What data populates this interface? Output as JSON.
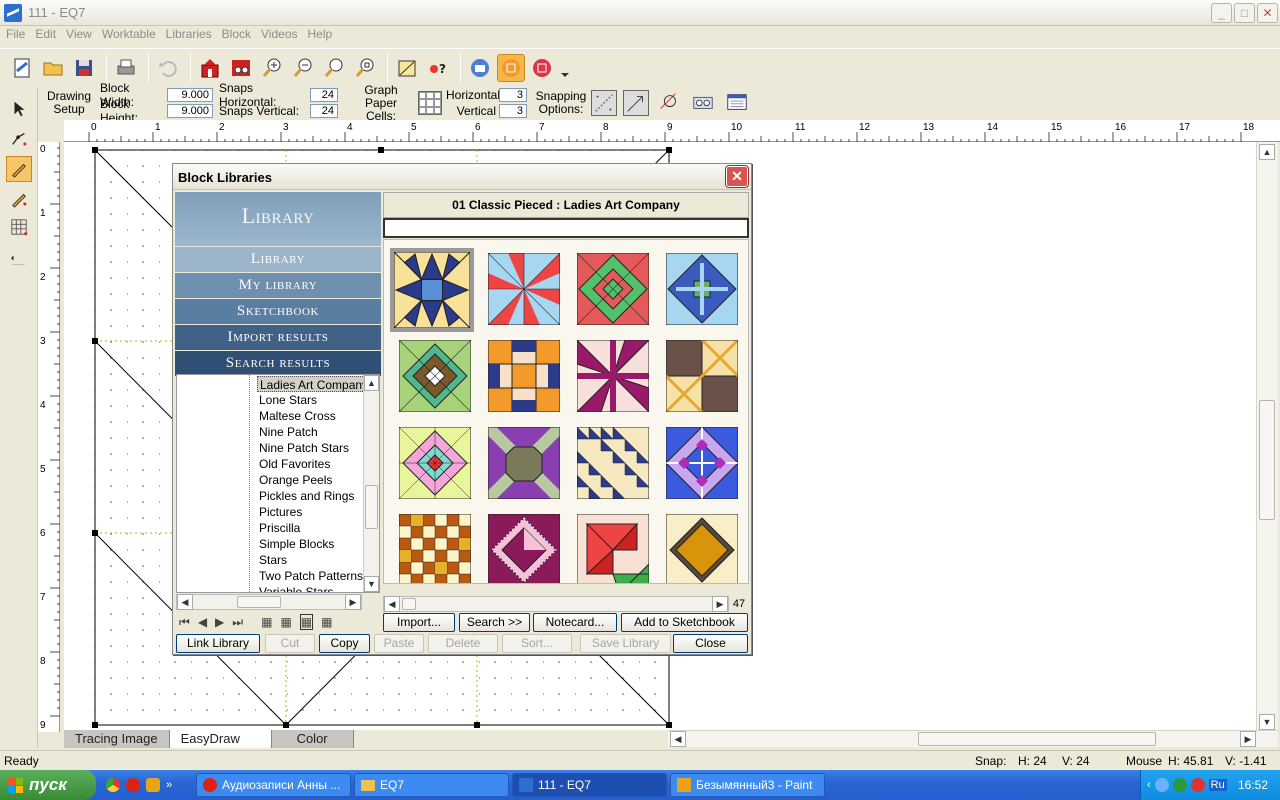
{
  "window": {
    "title": "111 - EQ7",
    "minimize": "_",
    "maximize": "□",
    "close": "✕"
  },
  "menu": [
    "File",
    "Edit",
    "View",
    "Worktable",
    "Libraries",
    "Block",
    "Videos",
    "Help"
  ],
  "options": {
    "drawing_setup_line1": "Drawing",
    "drawing_setup_line2": "Setup",
    "block_width_label": "Block Width:",
    "block_width_value": "9.000",
    "block_height_label": "Block Height:",
    "block_height_value": "9.000",
    "snaps_h_label": "Snaps Horizontal:",
    "snaps_h_value": "24",
    "snaps_v_label": "Snaps Vertical:",
    "snaps_v_value": "24",
    "graph_paper_line1": "Graph Paper",
    "graph_paper_line2": "Cells:",
    "horizontal_label": "Horizontal",
    "horizontal_value": "3",
    "vertical_label": "Vertical",
    "vertical_value": "3",
    "snapping_line1": "Snapping",
    "snapping_line2": "Options:"
  },
  "ruler_h": [
    "0",
    "1",
    "2",
    "3",
    "4",
    "5",
    "6",
    "7",
    "8",
    "9",
    "10",
    "11",
    "12",
    "13",
    "14",
    "15",
    "16",
    "17",
    "18"
  ],
  "ruler_v": [
    "0",
    "1",
    "2",
    "3",
    "4",
    "5",
    "6",
    "7",
    "8",
    "9"
  ],
  "canvas_tabs": [
    "Tracing Image",
    "EasyDraw",
    "Color"
  ],
  "status": {
    "ready": "Ready",
    "snap": "Snap:",
    "snap_h": "H:  24",
    "snap_v": "V:  24",
    "mouse": "Mouse",
    "mouse_h": "H: 45.81",
    "mouse_v": "V:  -1.41"
  },
  "dialog": {
    "title": "Block Libraries",
    "library_header": "Library",
    "nav": [
      "Library",
      "My library",
      "Sketchbook",
      "Import results",
      "Search results"
    ],
    "collection_title": "01 Classic Pieced  :  Ladies Art Company",
    "tree_items": [
      "Ladies Art Company",
      "Lone Stars",
      "Maltese Cross",
      "Nine Patch",
      "Nine Patch Stars",
      "Old Favorites",
      "Orange Peels",
      "Pickles and Rings",
      "Pictures",
      "Priscilla",
      "Simple Blocks",
      "Stars",
      "Two Patch Patterns",
      "Variable Stars"
    ],
    "block_count": "47",
    "buttons_row1": [
      "Import...",
      "Search    >>",
      "Notecard...",
      "Add to Sketchbook"
    ],
    "buttons_row2": [
      "Link Library",
      "Cut",
      "Copy",
      "Paste",
      "Delete",
      "Sort...",
      "Save Library",
      "Close"
    ]
  },
  "taskbar": {
    "start": "пуск",
    "items": [
      "Аудиозаписи Анны ...",
      "EQ7",
      "111 - EQ7",
      "Безымянный3 - Paint"
    ],
    "lang": "Ru",
    "clock": "16:52"
  },
  "colors": {
    "library_nav": [
      "#9bb4c9",
      "#6f8fae",
      "#5a7ea1",
      "#3f6286",
      "#2f4f74"
    ]
  }
}
